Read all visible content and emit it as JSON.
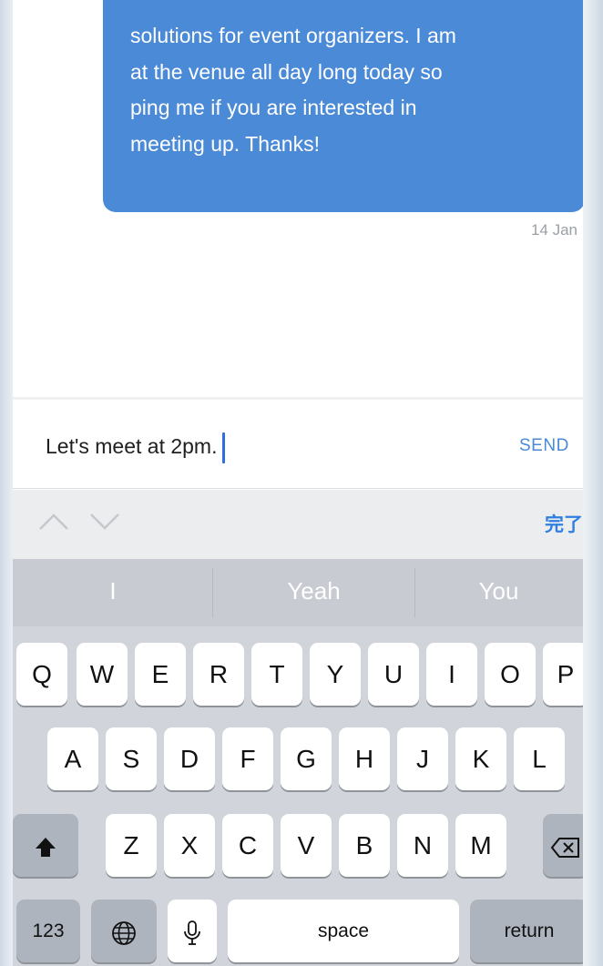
{
  "chat": {
    "message_lines": [
      "solutions for event organizers.  I am",
      "at the venue all day long today so",
      "ping me if you are interested in",
      "meeting up.  Thanks!"
    ],
    "timestamp": "14 Jan"
  },
  "composer": {
    "value": "Let's meet at 2pm.",
    "send_label": "SEND"
  },
  "accessory": {
    "done_label": "完了"
  },
  "keyboard": {
    "suggestions": [
      "I",
      "Yeah",
      "You"
    ],
    "row1": [
      "Q",
      "W",
      "E",
      "R",
      "T",
      "Y",
      "U",
      "I",
      "O",
      "P"
    ],
    "row2": [
      "A",
      "S",
      "D",
      "F",
      "G",
      "H",
      "J",
      "K",
      "L"
    ],
    "row3": [
      "Z",
      "X",
      "C",
      "V",
      "B",
      "N",
      "M"
    ],
    "numbers_label": "123",
    "space_label": "space",
    "return_label": "return"
  },
  "colors": {
    "bubble": "#4a8ad7",
    "accent": "#2f7fe0"
  },
  "icons": [
    "chevron-up-icon",
    "chevron-down-icon",
    "shift-icon",
    "delete-icon",
    "globe-icon",
    "microphone-icon"
  ]
}
